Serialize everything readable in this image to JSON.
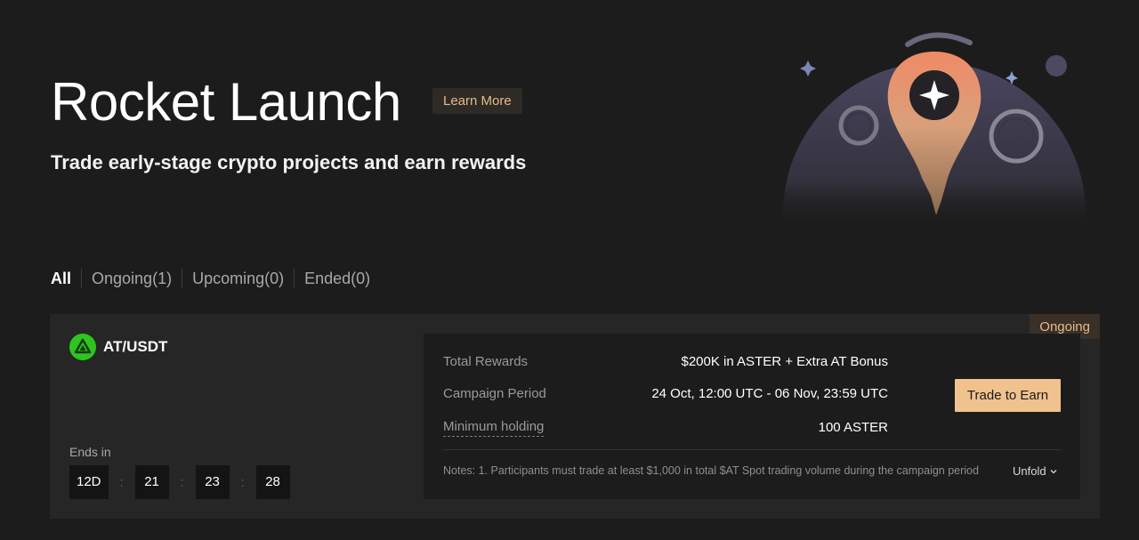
{
  "hero": {
    "title": "Rocket Launch",
    "learn_more": "Learn More",
    "subtitle": "Trade early-stage crypto projects and earn rewards"
  },
  "tabs": [
    {
      "label": "All",
      "active": true
    },
    {
      "label": "Ongoing(1)",
      "active": false
    },
    {
      "label": "Upcoming(0)",
      "active": false
    },
    {
      "label": "Ended(0)",
      "active": false
    }
  ],
  "campaign": {
    "status": "Ongoing",
    "pair": "AT/USDT",
    "pair_icon": "at-token-logo-icon",
    "ends_label": "Ends in",
    "countdown": {
      "days": "12D",
      "hours": "21",
      "minutes": "23",
      "seconds": "28"
    },
    "rows": [
      {
        "label": "Total Rewards",
        "value": "$200K in ASTER + Extra AT Bonus"
      },
      {
        "label": "Campaign Period",
        "value": "24 Oct, 12:00 UTC - 06 Nov, 23:59 UTC"
      },
      {
        "label": "Minimum holding",
        "value": "100 ASTER"
      }
    ],
    "trade_button": "Trade to Earn",
    "notes": "Notes: 1. Participants must trade at least $1,000 in total $AT Spot trading volume during the campaign period",
    "unfold": "Unfold"
  },
  "colors": {
    "background": "#1c1c1c",
    "card": "#262626",
    "accent": "#efc28e",
    "accent_text": "#e6b98a",
    "token_green": "#2ec51f"
  }
}
